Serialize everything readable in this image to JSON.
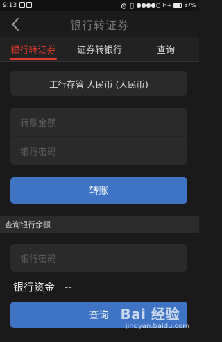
{
  "status_bar": {
    "time": "9:13",
    "network": "H+",
    "battery_percent": "87%",
    "battery_level": 0.87
  },
  "nav": {
    "title": "银行转证券",
    "back_icon": "chevron-left-icon"
  },
  "tabs": [
    {
      "label": "银行转证券",
      "active": true
    },
    {
      "label": "证券转银行",
      "active": false
    },
    {
      "label": "查询",
      "active": false
    }
  ],
  "transfer_form": {
    "account": "工行存管 人民币 (人民币)",
    "amount_placeholder": "转账金额",
    "password_placeholder": "银行密码",
    "submit_label": "转账"
  },
  "balance_query": {
    "section_title": "查询银行余额",
    "password_placeholder": "银行密码",
    "balance_label": "银行资金",
    "balance_value": "--",
    "query_label": "查询"
  },
  "watermark": {
    "logo_text": "Bai 经验",
    "url": "jingyan.baidu.com"
  },
  "colors": {
    "accent_red": "#e63a2f",
    "button_blue": "#3f74c4",
    "background": "#1a1a1a"
  }
}
